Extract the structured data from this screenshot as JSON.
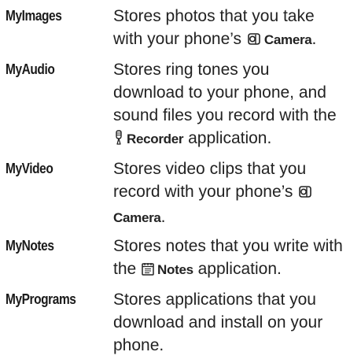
{
  "entries": [
    {
      "term": "MyImages",
      "desc_a": "Stores photos that you take with your phone’s ",
      "icon": "camera-icon",
      "keyword": "Camera",
      "desc_b": "."
    },
    {
      "term": "MyAudio",
      "desc_a": "Stores ring tones you download to your phone, and sound files you record with the ",
      "icon": "microphone-icon",
      "keyword": "Recorder",
      "desc_b": " application."
    },
    {
      "term": "MyVideo",
      "desc_a": "Stores video clips that you record with your phone’s ",
      "icon": "camera-icon",
      "keyword": "Camera",
      "desc_b": "."
    },
    {
      "term": "MyNotes",
      "desc_a": "Stores notes that you write with the ",
      "icon": "notes-icon",
      "keyword": "Notes",
      "desc_b": " application."
    },
    {
      "term": "MyPrograms",
      "desc": "Stores applications that you download and install on your phone."
    }
  ]
}
